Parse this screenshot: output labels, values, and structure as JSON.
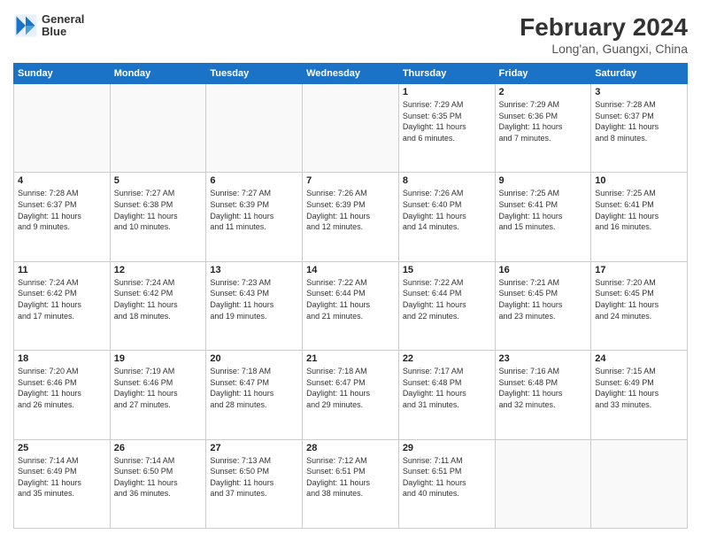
{
  "header": {
    "logo_line1": "General",
    "logo_line2": "Blue",
    "title": "February 2024",
    "subtitle": "Long'an, Guangxi, China"
  },
  "weekdays": [
    "Sunday",
    "Monday",
    "Tuesday",
    "Wednesday",
    "Thursday",
    "Friday",
    "Saturday"
  ],
  "weeks": [
    [
      {
        "day": "",
        "info": ""
      },
      {
        "day": "",
        "info": ""
      },
      {
        "day": "",
        "info": ""
      },
      {
        "day": "",
        "info": ""
      },
      {
        "day": "1",
        "info": "Sunrise: 7:29 AM\nSunset: 6:35 PM\nDaylight: 11 hours\nand 6 minutes."
      },
      {
        "day": "2",
        "info": "Sunrise: 7:29 AM\nSunset: 6:36 PM\nDaylight: 11 hours\nand 7 minutes."
      },
      {
        "day": "3",
        "info": "Sunrise: 7:28 AM\nSunset: 6:37 PM\nDaylight: 11 hours\nand 8 minutes."
      }
    ],
    [
      {
        "day": "4",
        "info": "Sunrise: 7:28 AM\nSunset: 6:37 PM\nDaylight: 11 hours\nand 9 minutes."
      },
      {
        "day": "5",
        "info": "Sunrise: 7:27 AM\nSunset: 6:38 PM\nDaylight: 11 hours\nand 10 minutes."
      },
      {
        "day": "6",
        "info": "Sunrise: 7:27 AM\nSunset: 6:39 PM\nDaylight: 11 hours\nand 11 minutes."
      },
      {
        "day": "7",
        "info": "Sunrise: 7:26 AM\nSunset: 6:39 PM\nDaylight: 11 hours\nand 12 minutes."
      },
      {
        "day": "8",
        "info": "Sunrise: 7:26 AM\nSunset: 6:40 PM\nDaylight: 11 hours\nand 14 minutes."
      },
      {
        "day": "9",
        "info": "Sunrise: 7:25 AM\nSunset: 6:41 PM\nDaylight: 11 hours\nand 15 minutes."
      },
      {
        "day": "10",
        "info": "Sunrise: 7:25 AM\nSunset: 6:41 PM\nDaylight: 11 hours\nand 16 minutes."
      }
    ],
    [
      {
        "day": "11",
        "info": "Sunrise: 7:24 AM\nSunset: 6:42 PM\nDaylight: 11 hours\nand 17 minutes."
      },
      {
        "day": "12",
        "info": "Sunrise: 7:24 AM\nSunset: 6:42 PM\nDaylight: 11 hours\nand 18 minutes."
      },
      {
        "day": "13",
        "info": "Sunrise: 7:23 AM\nSunset: 6:43 PM\nDaylight: 11 hours\nand 19 minutes."
      },
      {
        "day": "14",
        "info": "Sunrise: 7:22 AM\nSunset: 6:44 PM\nDaylight: 11 hours\nand 21 minutes."
      },
      {
        "day": "15",
        "info": "Sunrise: 7:22 AM\nSunset: 6:44 PM\nDaylight: 11 hours\nand 22 minutes."
      },
      {
        "day": "16",
        "info": "Sunrise: 7:21 AM\nSunset: 6:45 PM\nDaylight: 11 hours\nand 23 minutes."
      },
      {
        "day": "17",
        "info": "Sunrise: 7:20 AM\nSunset: 6:45 PM\nDaylight: 11 hours\nand 24 minutes."
      }
    ],
    [
      {
        "day": "18",
        "info": "Sunrise: 7:20 AM\nSunset: 6:46 PM\nDaylight: 11 hours\nand 26 minutes."
      },
      {
        "day": "19",
        "info": "Sunrise: 7:19 AM\nSunset: 6:46 PM\nDaylight: 11 hours\nand 27 minutes."
      },
      {
        "day": "20",
        "info": "Sunrise: 7:18 AM\nSunset: 6:47 PM\nDaylight: 11 hours\nand 28 minutes."
      },
      {
        "day": "21",
        "info": "Sunrise: 7:18 AM\nSunset: 6:47 PM\nDaylight: 11 hours\nand 29 minutes."
      },
      {
        "day": "22",
        "info": "Sunrise: 7:17 AM\nSunset: 6:48 PM\nDaylight: 11 hours\nand 31 minutes."
      },
      {
        "day": "23",
        "info": "Sunrise: 7:16 AM\nSunset: 6:48 PM\nDaylight: 11 hours\nand 32 minutes."
      },
      {
        "day": "24",
        "info": "Sunrise: 7:15 AM\nSunset: 6:49 PM\nDaylight: 11 hours\nand 33 minutes."
      }
    ],
    [
      {
        "day": "25",
        "info": "Sunrise: 7:14 AM\nSunset: 6:49 PM\nDaylight: 11 hours\nand 35 minutes."
      },
      {
        "day": "26",
        "info": "Sunrise: 7:14 AM\nSunset: 6:50 PM\nDaylight: 11 hours\nand 36 minutes."
      },
      {
        "day": "27",
        "info": "Sunrise: 7:13 AM\nSunset: 6:50 PM\nDaylight: 11 hours\nand 37 minutes."
      },
      {
        "day": "28",
        "info": "Sunrise: 7:12 AM\nSunset: 6:51 PM\nDaylight: 11 hours\nand 38 minutes."
      },
      {
        "day": "29",
        "info": "Sunrise: 7:11 AM\nSunset: 6:51 PM\nDaylight: 11 hours\nand 40 minutes."
      },
      {
        "day": "",
        "info": ""
      },
      {
        "day": "",
        "info": ""
      }
    ]
  ]
}
